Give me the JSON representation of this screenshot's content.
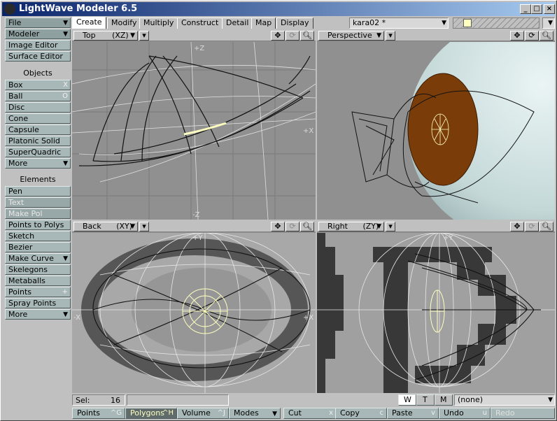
{
  "window": {
    "title": "LightWave Modeler 6.5",
    "min_btn": "_",
    "max_btn": "□",
    "close_btn": "×"
  },
  "sidebar": {
    "file": "File",
    "modeler": "Modeler",
    "image_editor": "Image Editor",
    "surface_editor": "Surface Editor",
    "objects_header": "Objects",
    "objects": [
      {
        "label": "Box",
        "shortcut": "X"
      },
      {
        "label": "Ball",
        "shortcut": "O"
      },
      {
        "label": "Disc",
        "shortcut": ""
      },
      {
        "label": "Cone",
        "shortcut": ""
      },
      {
        "label": "Capsule",
        "shortcut": ""
      },
      {
        "label": "Platonic Solid",
        "shortcut": ""
      },
      {
        "label": "SuperQuadric",
        "shortcut": ""
      },
      {
        "label": "More",
        "shortcut": ""
      }
    ],
    "elements_header": "Elements",
    "elements": [
      {
        "label": "Pen",
        "shortcut": ""
      },
      {
        "label": "Text",
        "shortcut": ""
      },
      {
        "label": "Make Pol",
        "shortcut": ""
      },
      {
        "label": "Points to Polys",
        "shortcut": ""
      },
      {
        "label": "Sketch",
        "shortcut": ""
      },
      {
        "label": "Bezier",
        "shortcut": ""
      },
      {
        "label": "Make Curve",
        "shortcut": ""
      },
      {
        "label": "Skelegons",
        "shortcut": ""
      },
      {
        "label": "Metaballs",
        "shortcut": ""
      },
      {
        "label": "Points",
        "shortcut": "+"
      },
      {
        "label": "Spray Points",
        "shortcut": ""
      },
      {
        "label": "More",
        "shortcut": ""
      }
    ]
  },
  "tabs": [
    "Create",
    "Modify",
    "Multiply",
    "Construct",
    "Detail",
    "Map",
    "Display"
  ],
  "active_tab": "Create",
  "object_select": {
    "value": "kara02 *"
  },
  "viewports": {
    "top": {
      "name": "Top",
      "axes": "(XZ)",
      "labels": {
        "z_top": "+Z",
        "x_right": "+X",
        "z_bottom": "-Z"
      }
    },
    "perspective": {
      "name": "Perspective",
      "axes": ""
    },
    "back": {
      "name": "Back",
      "axes": "(XY)",
      "labels": {
        "y_top": "+Y",
        "x_left": "-X",
        "x_right": "+X"
      }
    },
    "right": {
      "name": "Right",
      "axes": "(ZY)",
      "labels": {
        "y_top": "+Y"
      }
    }
  },
  "status": {
    "sel_label": "Sel:",
    "sel_value": "16",
    "wtm": [
      "W",
      "T",
      "M"
    ],
    "surface": "(none)"
  },
  "bottom_bar": [
    {
      "label": "Points",
      "shortcut": "^G"
    },
    {
      "label": "Polygons",
      "shortcut": "^H"
    },
    {
      "label": "Volume",
      "shortcut": "^J"
    },
    {
      "label": "Modes",
      "shortcut": ""
    },
    {
      "label": "Cut",
      "shortcut": "x"
    },
    {
      "label": "Copy",
      "shortcut": "c"
    },
    {
      "label": "Paste",
      "shortcut": "v"
    },
    {
      "label": "Undo",
      "shortcut": "u"
    },
    {
      "label": "Redo",
      "shortcut": ""
    }
  ],
  "colors": {
    "eye_iris": "#7a3d0a",
    "eye_ball": "#cfe0e0",
    "selection": "#ffffc0",
    "titlebar": "#0a246a"
  }
}
